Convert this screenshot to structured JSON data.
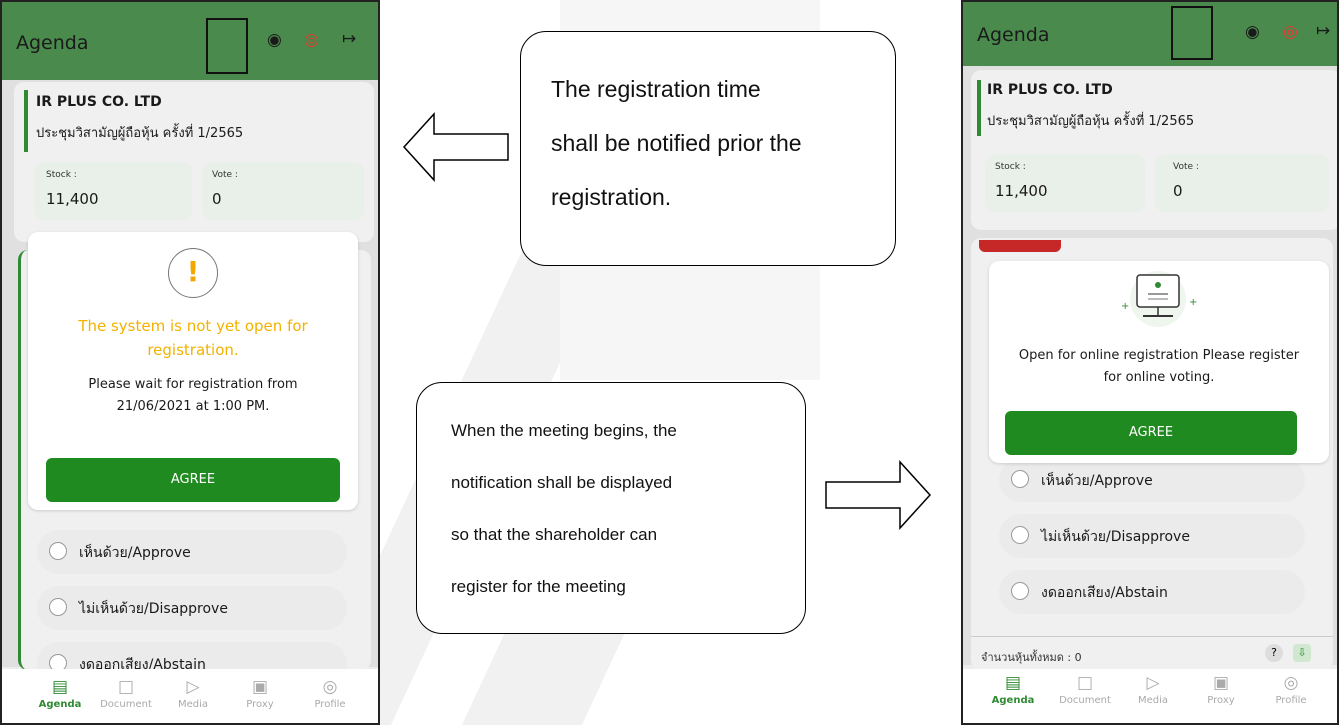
{
  "left_phone": {
    "title": "Agenda",
    "company": "IR PLUS CO. LTD",
    "meeting": "ประชุมวิสามัญผู้ถือหุ้น ครั้งที่ 1/2565",
    "stock_label": "Stock :",
    "stock_value": "11,400",
    "vote_label": "Vote :",
    "vote_value": "0",
    "modal": {
      "headline_1": "The system is not yet open for",
      "headline_2": "registration.",
      "body_1": "Please wait for registration from",
      "body_2": "21/06/2021 at 1:00 PM.",
      "button": "AGREE"
    },
    "options": [
      "เห็นด้วย/Approve",
      "ไม่เห็นด้วย/Disapprove",
      "งดออกเสียง/Abstain"
    ],
    "nav": [
      "Agenda",
      "Document",
      "Media",
      "Proxy",
      "Profile"
    ]
  },
  "right_phone": {
    "title": "Agenda",
    "company": "IR PLUS CO. LTD",
    "meeting": "ประชุมวิสามัญผู้ถือหุ้น ครั้งที่ 1/2565",
    "stock_label": "Stock :",
    "stock_value": "11,400",
    "vote_label": "Vote :",
    "vote_value": "0",
    "modal": {
      "body_1": "Open for online registration Please register",
      "body_2": "for online voting.",
      "button": "AGREE"
    },
    "options": [
      "เห็นด้วย/Approve",
      "ไม่เห็นด้วย/Disapprove",
      "งดออกเสียง/Abstain"
    ],
    "total_shares": "จำนวนหุ้นทั้งหมด : 0",
    "nav": [
      "Agenda",
      "Document",
      "Media",
      "Proxy",
      "Profile"
    ]
  },
  "callout_top": {
    "line1": "The registration time",
    "line2": "shall be notified prior the",
    "line3": "registration."
  },
  "callout_bottom": {
    "line1": "When the meeting begins, the",
    "line2": "notification shall be displayed",
    "line3": "so that the shareholder can",
    "line4": "register for the meeting"
  },
  "icons": {
    "chat": "chat-icon",
    "broadcast": "broadcast-icon",
    "logout": "logout-icon",
    "warning": "warning-icon",
    "computer": "computer-user-icon"
  },
  "colors": {
    "topbar": "#4a8a4c",
    "agree": "#1f8a1f",
    "warning_text": "#f2b200",
    "accent": "#2f8a33"
  }
}
